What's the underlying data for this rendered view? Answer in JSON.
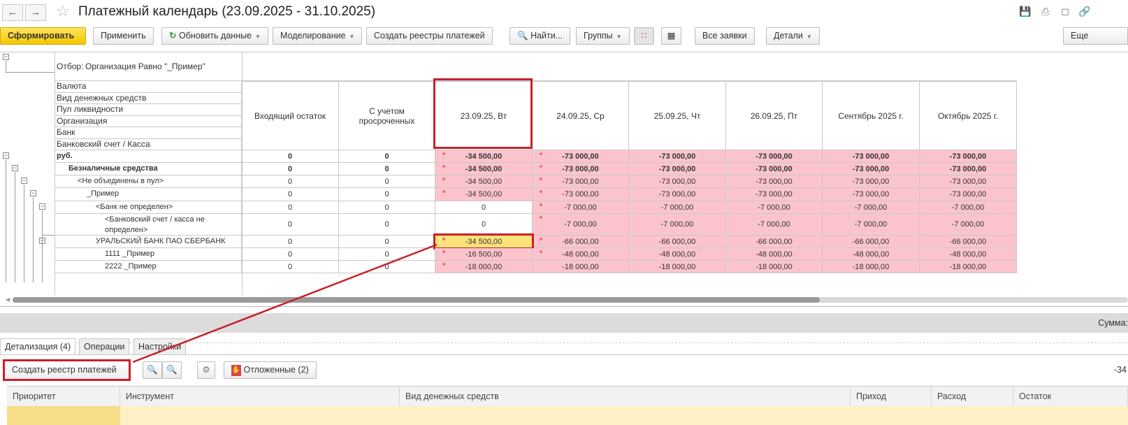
{
  "window": {
    "title": "Платежный календарь (23.09.2025 - 31.10.2025)"
  },
  "toolbar": {
    "generate": "Сформировать",
    "apply": "Применить",
    "refresh": "Обновить данные",
    "modeling": "Моделирование",
    "create_registers": "Создать реестры платежей",
    "find": "Найти...",
    "groups": "Группы",
    "all_requests": "Все заявки",
    "details": "Детали",
    "more": "Еще"
  },
  "filter": {
    "label": "Отбор:",
    "value": "Организация Равно \"_Пример\""
  },
  "grouping_headers": [
    "Валюта",
    "Вид денежных средств",
    "Пул ликвидности",
    "Организация",
    "Банк",
    "Банковский счет / Касса"
  ],
  "columns": [
    "Входящий остаток",
    "С учетом просроченных",
    "23.09.25, Вт",
    "24.09.25, Ср",
    "25.09.25, Чт",
    "26.09.25, Пт",
    "Сентябрь 2025 г.",
    "Октябрь 2025 г."
  ],
  "rows": [
    {
      "label": "руб.",
      "level": 0,
      "bold": true,
      "values": [
        "0",
        "0",
        "-34 500,00",
        "-73 000,00",
        "-73 000,00",
        "-73 000,00",
        "-73 000,00",
        "-73 000,00"
      ],
      "pink": [
        2,
        3,
        4,
        5,
        6,
        7
      ],
      "dots": [
        2,
        3
      ]
    },
    {
      "label": "Безналичные средства",
      "level": 1,
      "bold": true,
      "values": [
        "0",
        "0",
        "-34 500,00",
        "-73 000,00",
        "-73 000,00",
        "-73 000,00",
        "-73 000,00",
        "-73 000,00"
      ],
      "pink": [
        2,
        3,
        4,
        5,
        6,
        7
      ],
      "dots": [
        2,
        3
      ]
    },
    {
      "label": "<Не объединены в пул>",
      "level": 2,
      "values": [
        "0",
        "0",
        "-34 500,00",
        "-73 000,00",
        "-73 000,00",
        "-73 000,00",
        "-73 000,00",
        "-73 000,00"
      ],
      "pink": [
        2,
        3,
        4,
        5,
        6,
        7
      ],
      "dots": [
        2,
        3
      ]
    },
    {
      "label": "_Пример",
      "level": 3,
      "values": [
        "0",
        "0",
        "-34 500,00",
        "-73 000,00",
        "-73 000,00",
        "-73 000,00",
        "-73 000,00",
        "-73 000,00"
      ],
      "pink": [
        2,
        3,
        4,
        5,
        6,
        7
      ],
      "dots": [
        2,
        3
      ]
    },
    {
      "label": "<Банк не определен>",
      "level": 4,
      "values": [
        "0",
        "0",
        "0",
        "-7 000,00",
        "-7 000,00",
        "-7 000,00",
        "-7 000,00",
        "-7 000,00"
      ],
      "pink": [
        3,
        4,
        5,
        6,
        7
      ],
      "dots": [
        3
      ]
    },
    {
      "label": "<Банковский счет / касса не определен>",
      "level": 5,
      "values": [
        "0",
        "0",
        "0",
        "-7 000,00",
        "-7 000,00",
        "-7 000,00",
        "-7 000,00",
        "-7 000,00"
      ],
      "pink": [
        3,
        4,
        5,
        6,
        7
      ],
      "dots": [
        3
      ]
    },
    {
      "label": "УРАЛЬСКИЙ БАНК ПАО СБЕРБАНК",
      "level": 4,
      "values": [
        "0",
        "0",
        "-34 500,00",
        "-66 000,00",
        "-66 000,00",
        "-66 000,00",
        "-66 000,00",
        "-66 000,00"
      ],
      "pink": [
        3,
        4,
        5,
        6,
        7
      ],
      "dots": [
        2,
        3
      ],
      "selected": 2
    },
    {
      "label": "1111 _Пример",
      "level": 5,
      "values": [
        "0",
        "0",
        "-16 500,00",
        "-48 000,00",
        "-48 000,00",
        "-48 000,00",
        "-48 000,00",
        "-48 000,00"
      ],
      "pink": [
        2,
        3,
        4,
        5,
        6,
        7
      ],
      "dots": [
        2,
        3
      ]
    },
    {
      "label": "2222 _Пример",
      "level": 5,
      "values": [
        "0",
        "0",
        "-18 000,00",
        "-18 000,00",
        "-18 000,00",
        "-18 000,00",
        "-18 000,00",
        "-18 000,00"
      ],
      "pink": [
        2,
        3,
        4,
        5,
        6,
        7
      ],
      "dots": [
        2
      ]
    }
  ],
  "summary": {
    "label": "Сумма:",
    "value": "-34"
  },
  "tabs": [
    {
      "label": "Детализация (4)",
      "active": true
    },
    {
      "label": "Операции"
    },
    {
      "label": "Настройки"
    }
  ],
  "detail_toolbar": {
    "create_register": "Создать реестр платежей",
    "postponed": "Отложенные (2)"
  },
  "detail_columns": [
    "Приоритет",
    "Инструмент",
    "Вид денежных средств",
    "Приход",
    "Расход",
    "Остаток"
  ],
  "colors": {
    "pink": "#fbc4cc",
    "selected": "#fde37a",
    "highlight": "#c8202c",
    "primary": "#f5cb0c"
  }
}
